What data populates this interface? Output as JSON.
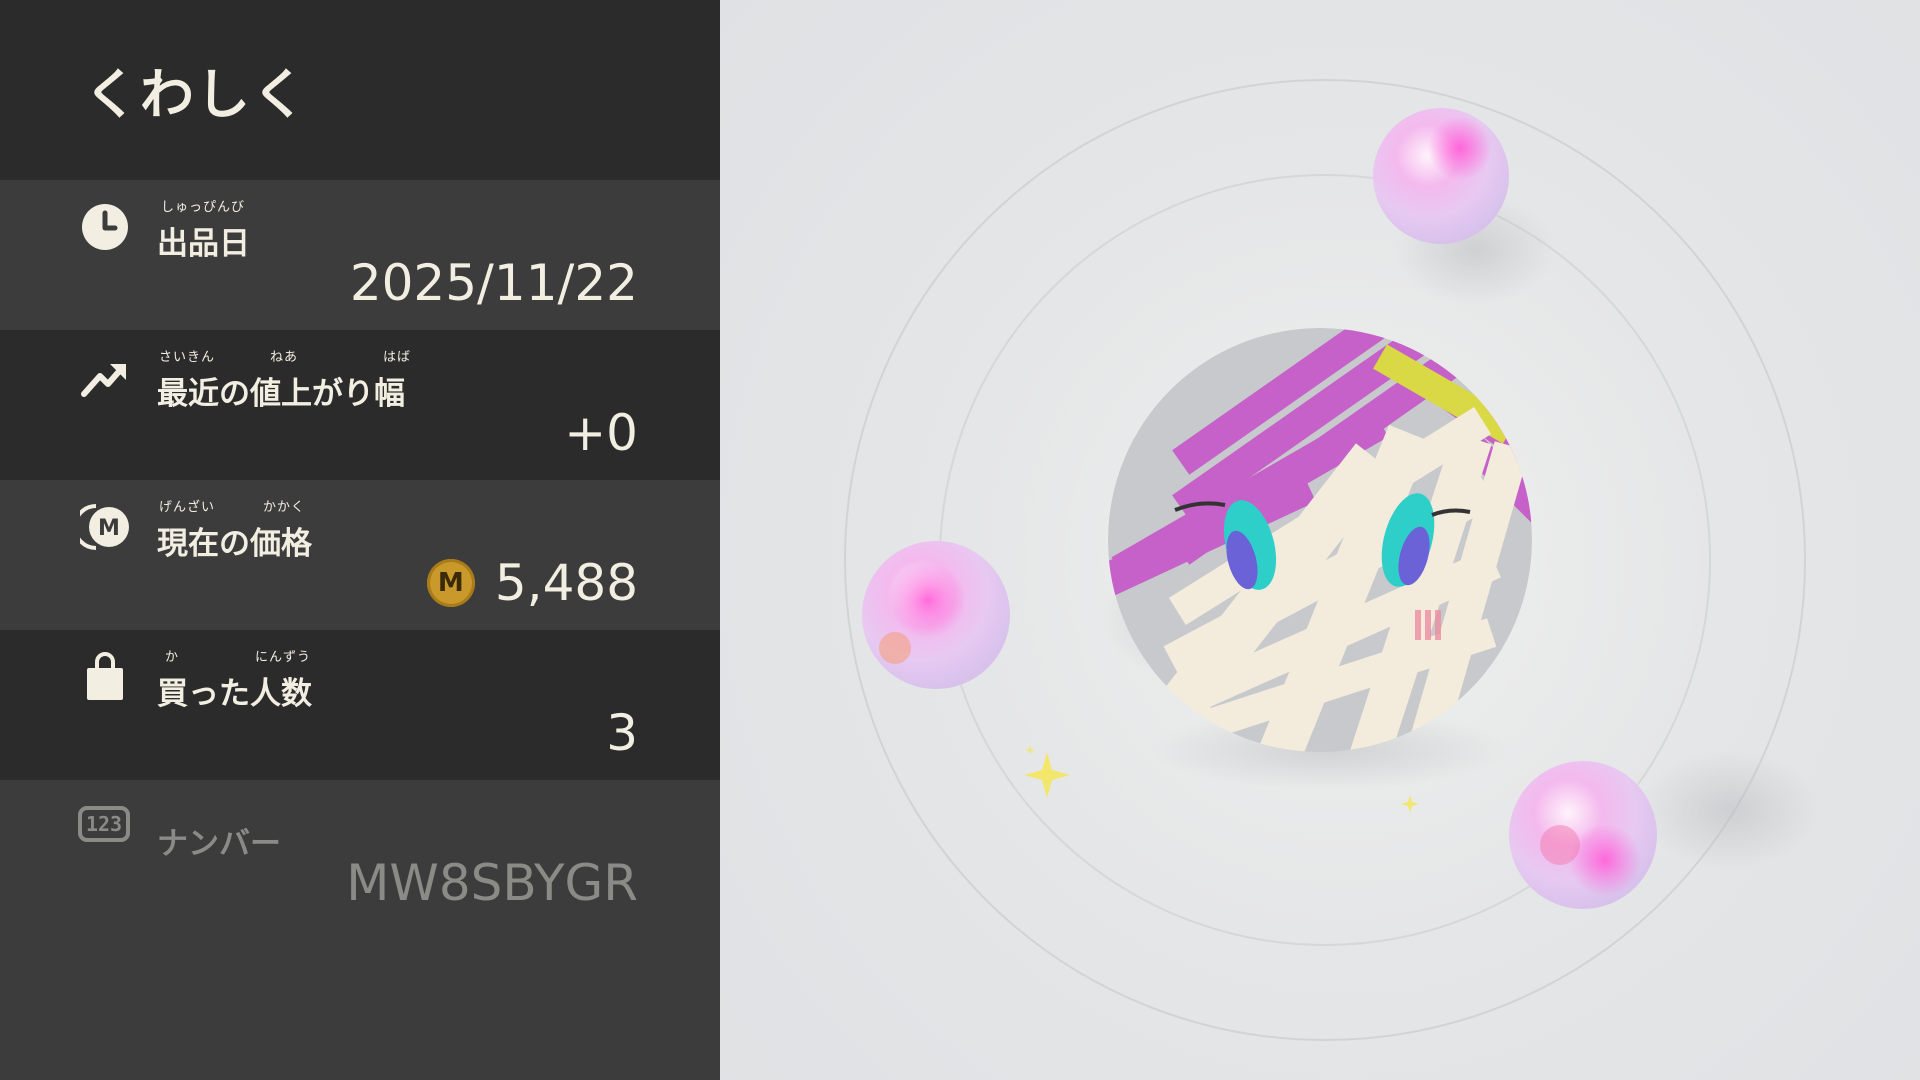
{
  "header": {
    "title": "くわしく"
  },
  "rows": [
    {
      "name": "listing-date",
      "icon": "clock-icon",
      "ruby": "しゅっぴんび",
      "label": "出品日",
      "value": "2025/11/22"
    },
    {
      "name": "recent-increase",
      "icon": "trend-up-icon",
      "ruby": [
        "さいきん",
        "ねあ",
        "はば"
      ],
      "label": "最近の値上がり幅",
      "value": "+0"
    },
    {
      "name": "current-price",
      "icon": "price-coin-icon",
      "ruby": [
        "げんざい",
        "かかく"
      ],
      "label": "現在の価格",
      "coin_label": "M",
      "value": "5,488"
    },
    {
      "name": "buyers-count",
      "icon": "shopping-bag-icon",
      "ruby": [
        "か",
        "にんずう"
      ],
      "label": "買った人数",
      "value": "3"
    },
    {
      "name": "item-number",
      "icon": "number-badge-icon",
      "badge": "123",
      "label": "ナンバー",
      "value": "MW8SBYGR"
    }
  ],
  "scene": {
    "object": "yarn-ball-character",
    "colors": {
      "magenta": "#c561c8",
      "cream": "#f3ecdc",
      "yellow": "#d9d845",
      "teal": "#2ecfc8",
      "pink-orb": "#f4a8ee"
    }
  }
}
